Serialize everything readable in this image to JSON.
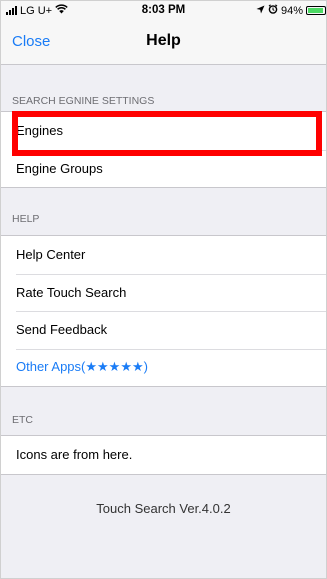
{
  "status_bar": {
    "carrier": "LG U+",
    "time": "8:03 PM",
    "battery": "94%",
    "battery_level": 0.94
  },
  "nav": {
    "close_label": "Close",
    "title": "Help"
  },
  "sections": {
    "search_engine": {
      "header": "SEARCH EGNINE SETTINGS",
      "items": [
        "Engines",
        "Engine Groups"
      ]
    },
    "help": {
      "header": "HELP",
      "items": [
        "Help Center",
        "Rate Touch Search",
        "Send Feedback",
        "Other Apps(★★★★★)"
      ]
    },
    "etc": {
      "header": "ETC",
      "items": [
        "Icons are from here."
      ]
    }
  },
  "version": "Touch Search Ver.4.0.2",
  "colors": {
    "accent": "#1a7cf6",
    "highlight": "#ff0000",
    "background": "#efeff4"
  },
  "icons": [
    "signal-icon",
    "wifi-icon",
    "location-icon",
    "alarm-icon",
    "battery-icon"
  ]
}
